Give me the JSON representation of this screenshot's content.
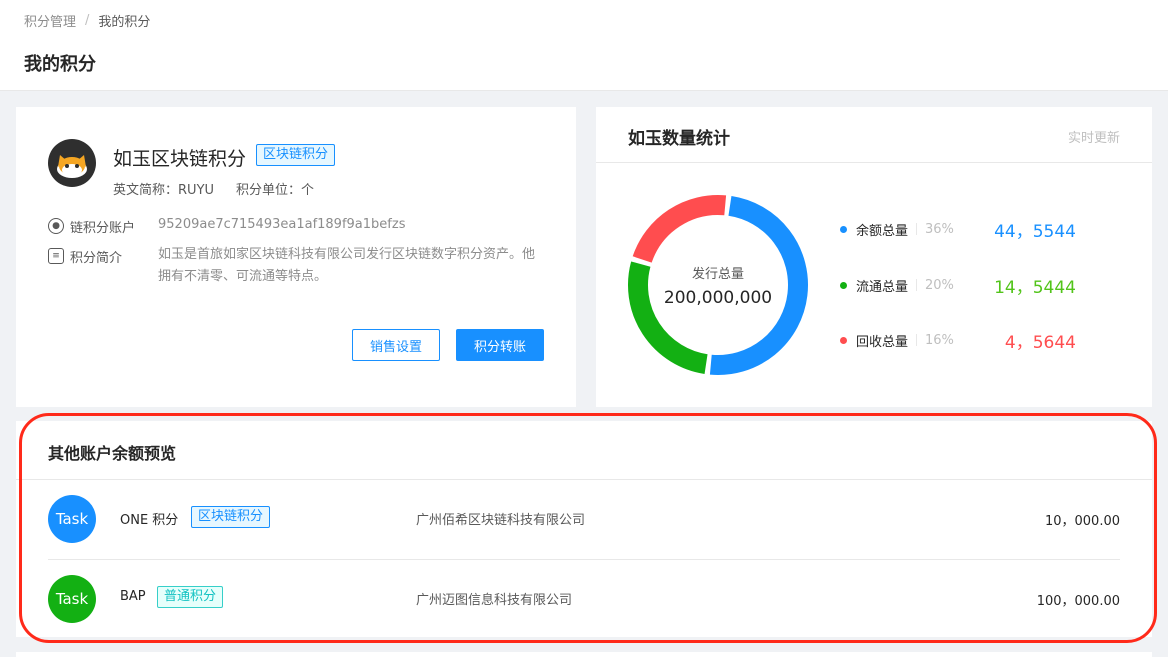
{
  "breadcrumb": {
    "parent": "积分管理",
    "separator": "/",
    "current": "我的积分"
  },
  "page_title": "我的积分",
  "token": {
    "name": "如玉区块链积分",
    "tag": "区块链积分",
    "en_label": "英文简称：",
    "en_value": "RUYU",
    "unit_label": "积分单位：",
    "unit_value": "个",
    "account_label": "链积分账户",
    "account_value": "95209ae7c715493ea1af189f9a1befzs",
    "intro_label": "积分简介",
    "intro_value": "如玉是首旅如家区块链科技有限公司发行区块链数字积分资产。他拥有不清零、可流通等特点。",
    "btn_sale": "销售设置",
    "btn_transfer": "积分转账"
  },
  "stats": {
    "title": "如玉数量统计",
    "refresh": "实时更新",
    "center_label": "发行总量",
    "center_value": "200,000,000",
    "legend": [
      {
        "name": "余额总量",
        "pct": "36%",
        "value": "44，5544",
        "color": "#1890ff"
      },
      {
        "name": "流通总量",
        "pct": "20%",
        "value": "14，5444",
        "color": "#13b013"
      },
      {
        "name": "回收总量",
        "pct": "16%",
        "value": "4，5644",
        "color": "#ff4d4f"
      }
    ]
  },
  "chart_data": {
    "type": "pie",
    "categories": [
      "余额总量",
      "流通总量",
      "回收总量"
    ],
    "values": [
      36,
      20,
      16
    ],
    "colors": [
      "#1890ff",
      "#13b013",
      "#ff4d4f"
    ]
  },
  "others": {
    "title": "其他账户余额预览",
    "rows": [
      {
        "avatar": "Task",
        "avatar_color": "#1890ff",
        "name": "ONE 积分",
        "tag": "区块链积分",
        "company": "广州佰希区块链科技有限公司",
        "amount": "10，000.00"
      },
      {
        "avatar": "Task",
        "avatar_color": "#13b013",
        "name": "BAP",
        "tag": "普通积分",
        "company": "广州迈图信息科技有限公司",
        "amount": "100，000.00"
      }
    ]
  }
}
